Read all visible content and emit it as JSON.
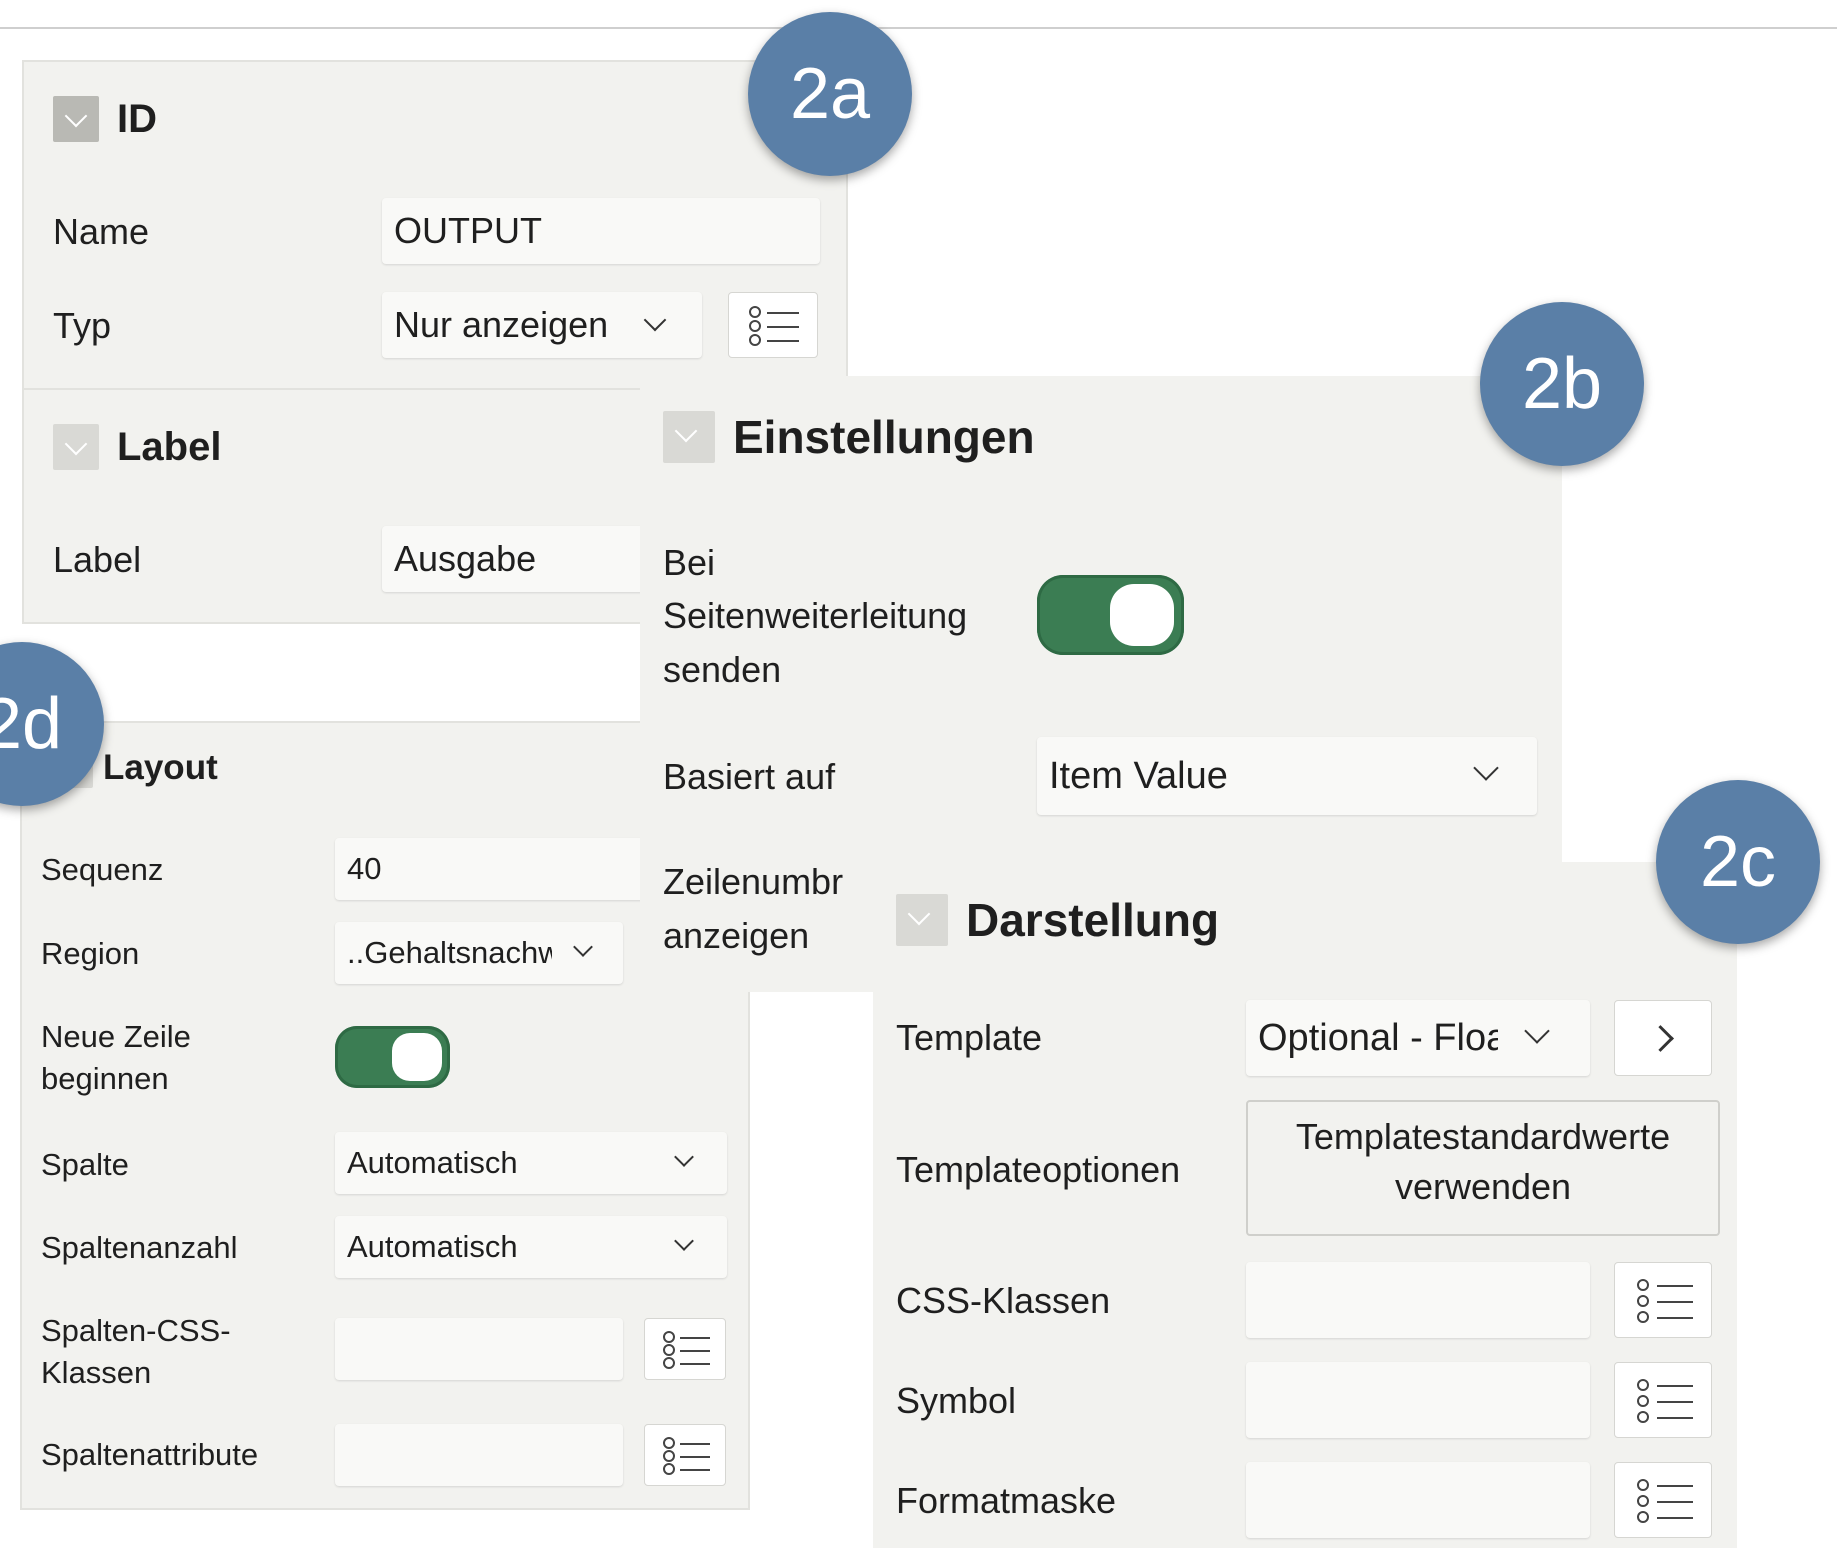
{
  "panel_id": {
    "header": "ID",
    "name_label": "Name",
    "name_value": "OUTPUT",
    "type_label": "Typ",
    "type_value": "Nur anzeigen",
    "list_icon": "list-icon"
  },
  "panel_label": {
    "header": "Label",
    "label_label": "Label",
    "label_value": "Ausgabe"
  },
  "panel_settings": {
    "header": "Einstellungen",
    "send_label_1": "Bei",
    "send_label_2": "Seitenweiterleitung",
    "send_label_3": "senden",
    "send_toggle": "on",
    "based_on_label": "Basiert auf",
    "based_on_value": "Item Value",
    "linebreak_label_1": "Zeilenumbr",
    "linebreak_label_2": "anzeigen"
  },
  "panel_appearance": {
    "header": "Darstellung",
    "template_label": "Template",
    "template_value": "Optional - Floa",
    "template_options_label": "Templateoptionen",
    "template_options_button_1": "Templatestandardwerte",
    "template_options_button_2": "verwenden",
    "css_label": "CSS-Klassen",
    "symbol_label": "Symbol",
    "format_label": "Formatmaske"
  },
  "panel_layout": {
    "header": "Layout",
    "sequence_label": "Sequenz",
    "sequence_value": "40",
    "region_label": "Region",
    "region_value": "..Gehaltsnachw",
    "new_row_label_1": "Neue Zeile",
    "new_row_label_2": "beginnen",
    "new_row_toggle": "on",
    "column_label": "Spalte",
    "column_value": "Automatisch",
    "column_span_label": "Spaltenanzahl",
    "column_span_value": "Automatisch",
    "column_css_label_1": "Spalten-CSS-",
    "column_css_label_2": "Klassen",
    "column_attr_label": "Spaltenattribute"
  },
  "badges": {
    "a": "2a",
    "b": "2b",
    "c": "2c",
    "d": "2d"
  },
  "colors": {
    "badge": "#5a7fa7",
    "toggle_on": "#3b7d53",
    "panel_bg": "#f2f2ef"
  }
}
